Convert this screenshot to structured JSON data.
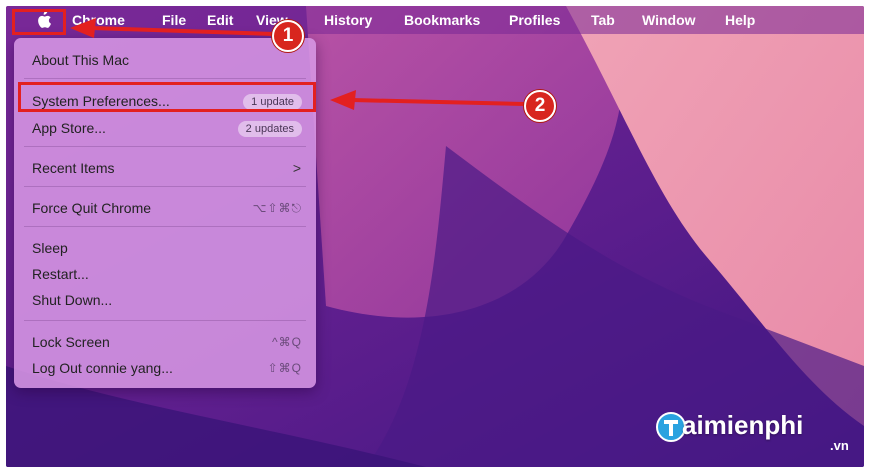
{
  "menubar": {
    "items": [
      "Chrome",
      "File",
      "Edit",
      "View",
      "History",
      "Bookmarks",
      "Profiles",
      "Tab",
      "Window",
      "Help"
    ]
  },
  "apple_menu": {
    "about": "About This Mac",
    "system_preferences": "System Preferences...",
    "system_preferences_badge": "1 update",
    "app_store": "App Store...",
    "app_store_badge": "2 updates",
    "recent_items": "Recent Items",
    "recent_items_chevron": ">",
    "force_quit": "Force Quit Chrome",
    "force_quit_shortcut": "⌥⇧⌘⎋",
    "sleep": "Sleep",
    "restart": "Restart...",
    "shut_down": "Shut Down...",
    "lock_screen": "Lock Screen",
    "lock_screen_shortcut": "^⌘Q",
    "log_out": "Log Out connie yang...",
    "log_out_shortcut": "⇧⌘Q"
  },
  "annotations": {
    "step1": "1",
    "step2": "2",
    "highlight_color": "#e32020"
  },
  "watermark": {
    "text": "aimienphi",
    "suffix": ".vn"
  }
}
